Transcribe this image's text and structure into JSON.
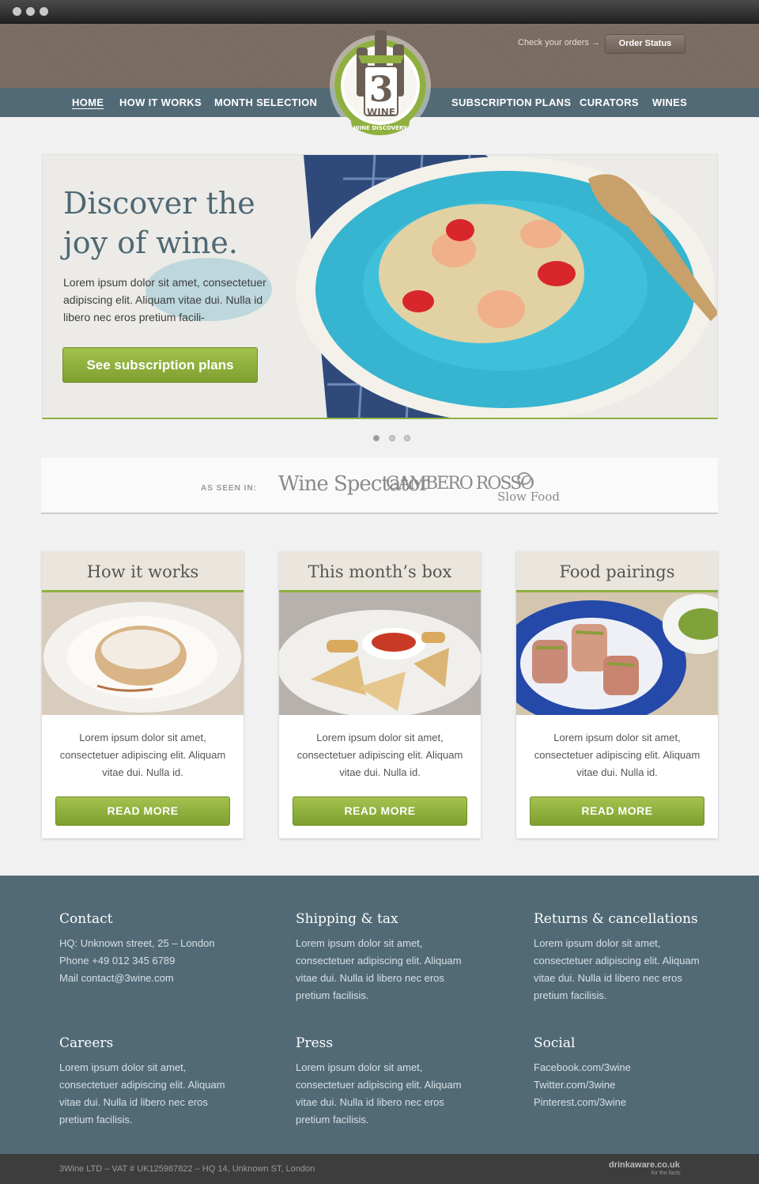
{
  "header": {
    "order_link": "Check your orders →",
    "order_button": "Order Status",
    "nav": [
      "HOME",
      "HOW IT WORKS",
      "MONTH SELECTION",
      "SUBSCRIPTION PLANS",
      "CURATORS",
      "WINES"
    ],
    "logo": {
      "number": "3",
      "word": "WINE",
      "tagline": "WINE DISCOVERY"
    }
  },
  "hero": {
    "title": "Discover the joy of wine.",
    "text": "Lorem ipsum dolor sit amet, consectetuer adipiscing elit. Aliquam vitae dui. Nulla id libero nec eros pretium facili-",
    "button": "See subscription plans"
  },
  "press": {
    "label": "AS SEEN IN:",
    "logos": [
      "Wine Spectator",
      "GAMBERO ROSSO",
      "Slow Food"
    ]
  },
  "cards": [
    {
      "title": "How it works",
      "text": "Lorem ipsum dolor sit amet, consectetuer adipiscing elit. Aliquam vitae dui. Nulla id.",
      "button": "READ MORE"
    },
    {
      "title": "This month’s box",
      "text": "Lorem ipsum dolor sit amet, consectetuer adipiscing elit. Aliquam vitae dui. Nulla id.",
      "button": "READ MORE"
    },
    {
      "title": "Food pairings",
      "text": "Lorem ipsum dolor sit amet, consectetuer adipiscing elit. Aliquam vitae dui. Nulla id.",
      "button": "READ MORE"
    }
  ],
  "footer": {
    "contact": {
      "title": "Contact",
      "lines": [
        "HQ:  Unknown street, 25 – London",
        "Phone  +49 012 345 6789",
        "Mail  contact@3wine.com"
      ]
    },
    "shipping": {
      "title": "Shipping & tax",
      "text": "Lorem ipsum dolor sit amet, consectetuer adipiscing elit. Aliquam vitae dui. Nulla id libero nec eros pretium facilisis."
    },
    "returns": {
      "title": "Returns & cancellations",
      "text": "Lorem ipsum dolor sit amet, consectetuer adipiscing elit. Aliquam vitae dui. Nulla id libero nec eros pretium facilisis."
    },
    "careers": {
      "title": "Careers",
      "text": "Lorem ipsum dolor sit amet, consectetuer adipiscing elit. Aliquam vitae dui. Nulla id libero nec eros pretium facilisis."
    },
    "press": {
      "title": "Press",
      "text": "Lorem ipsum dolor sit amet, consectetuer adipiscing elit. Aliquam vitae dui. Nulla id libero nec eros pretium facilisis."
    },
    "social": {
      "title": "Social",
      "lines": [
        "Facebook.com/3wine",
        "Twitter.com/3wine",
        "Pinterest.com/3wine"
      ]
    },
    "legal": "3Wine LTD – VAT # UK125987822 – HQ 14, Unknown ST, London",
    "drinkaware": "drinkaware.co.uk",
    "drinkaware_sub": "for the facts"
  },
  "colors": {
    "accent": "#8fb040",
    "nav": "#526a76",
    "header": "#7a6d63"
  }
}
